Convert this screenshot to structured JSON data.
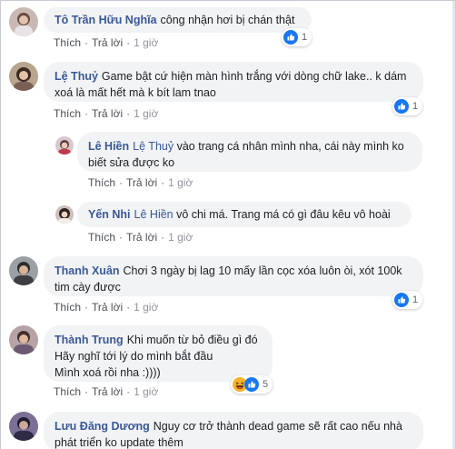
{
  "actions": {
    "like": "Thích",
    "reply": "Trả lời",
    "separator": "·"
  },
  "comments": [
    {
      "author": "Tô Trần Hữu Nghĩa",
      "text": "công nhận hơi bị chán thật",
      "time": "1 giờ",
      "reactions": {
        "icons": [
          "like-icon"
        ],
        "count": "1"
      }
    },
    {
      "author": "Lệ Thuỷ",
      "text": "Game bật cứ hiện màn hình trắng với dòng chữ lake.. k dám xoá là mất hết mà k bít lam tnao",
      "time": "1 giờ",
      "reactions": {
        "icons": [
          "like-icon"
        ],
        "count": "1"
      }
    },
    {
      "author": "Lê Hiền",
      "mention": "Lệ Thuỷ",
      "text": "vào trang cá nhân mình nha, cái này mình ko biết sửa được ko",
      "time": "1 giờ"
    },
    {
      "author": "Yến Nhi",
      "mention": "Lê Hiền",
      "text": "vô chi má. Trang má có gì đâu kêu vô hoài",
      "time": "1 giờ"
    },
    {
      "author": "Thanh Xuân",
      "text": "Chơi 3 ngày bị lag 10 mấy lần cọc xóa luôn òi, xót 100k tim cày được",
      "time": "1 giờ",
      "reactions": {
        "icons": [
          "like-icon"
        ],
        "count": "1"
      }
    },
    {
      "author": "Thành Trung",
      "text_lines": [
        "Khi muốn từ bỏ điều gì đó",
        "Hãy nghĩ tới lý do mình bắt đầu",
        "Mình xoá rồi nha :))))"
      ],
      "time": "1 giờ",
      "reactions": {
        "icons": [
          "haha-icon",
          "like-icon"
        ],
        "count": "5"
      }
    },
    {
      "author": "Lưu Đăng Dương",
      "text": "Nguy cơ trở thành dead game sẽ rất cao nếu nhà phát triển ko update thêm"
    }
  ],
  "colors": {
    "link": "#385898",
    "bubble": "#f2f3f5",
    "like": "#1877f2",
    "haha": "#f7b125"
  }
}
